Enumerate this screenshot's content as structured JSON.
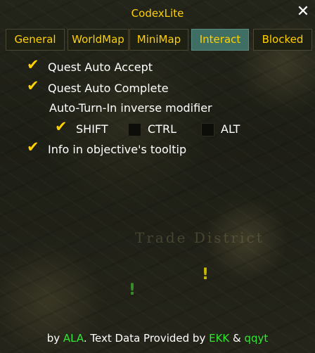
{
  "window": {
    "title": "CodexLite",
    "close_glyph": "✕"
  },
  "background": {
    "district_label": "Trade District",
    "markers": [
      "!",
      "!"
    ]
  },
  "tabs": [
    {
      "label": "General",
      "active": false
    },
    {
      "label": "WorldMap",
      "active": false
    },
    {
      "label": "MiniMap",
      "active": false
    },
    {
      "label": "Interact",
      "active": true
    },
    {
      "label": "Blocked",
      "active": false
    }
  ],
  "options": {
    "quest_auto_accept": {
      "label": "Quest Auto Accept",
      "checked": true
    },
    "quest_auto_complete": {
      "label": "Quest Auto Complete",
      "checked": true
    },
    "modifier_heading": "Auto-Turn-In inverse modifier",
    "modifiers": [
      {
        "label": "SHIFT",
        "checked": true
      },
      {
        "label": "CTRL",
        "checked": false
      },
      {
        "label": "ALT",
        "checked": false
      }
    ],
    "info_tooltip": {
      "label": "Info in objective's tooltip",
      "checked": true
    }
  },
  "footer": {
    "by": "by ",
    "author": "ALA",
    "middle": ". Text Data Provided by ",
    "source1": "EKK",
    "amp": " & ",
    "source2": "qqyt"
  },
  "colors": {
    "accent": "#ffd100",
    "active_tab": "#3f6f64",
    "credit_green": "#33e633"
  }
}
